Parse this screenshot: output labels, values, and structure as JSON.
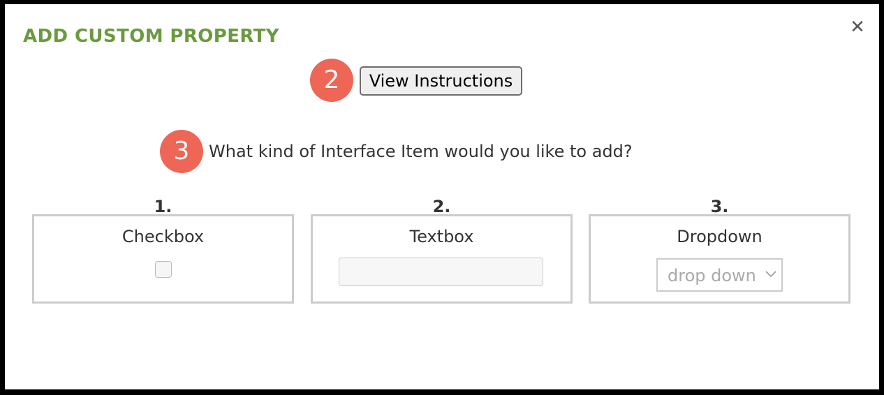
{
  "dialog": {
    "title": "ADD CUSTOM PROPERTY",
    "close_icon": "close-icon",
    "close_glyph": "✕"
  },
  "instructions": {
    "step_badge": "2",
    "button_label": "View Instructions"
  },
  "question": {
    "step_badge": "3",
    "text": "What kind of Interface Item would you like to add?"
  },
  "options": [
    {
      "number": "1.",
      "label": "Checkbox"
    },
    {
      "number": "2.",
      "label": "Textbox"
    },
    {
      "number": "3.",
      "label": "Dropdown",
      "placeholder": "drop down"
    }
  ],
  "colors": {
    "title_green": "#6b9a3e",
    "badge_red": "#ee6655",
    "card_border": "#cccccc"
  },
  "icons": {
    "dropdown_arrow": "chevron-down-icon"
  }
}
